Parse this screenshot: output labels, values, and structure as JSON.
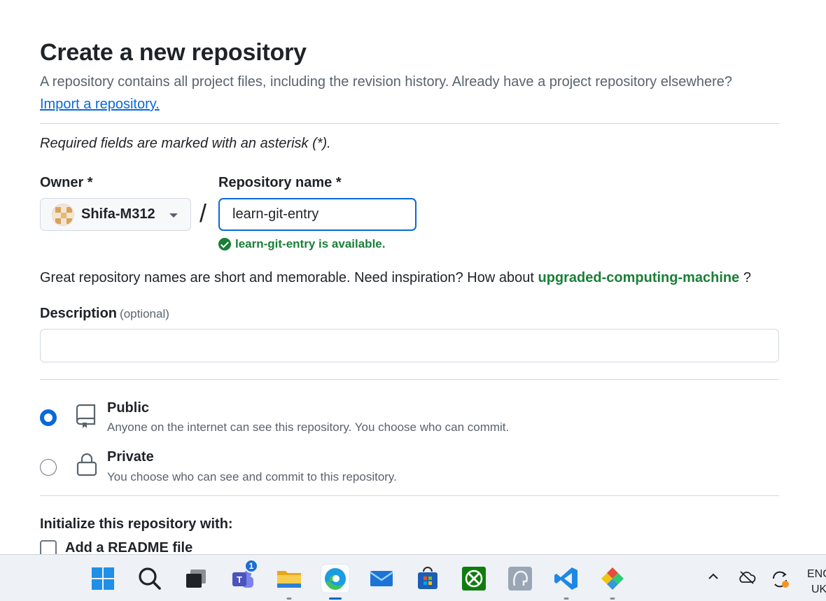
{
  "page": {
    "title": "Create a new repository",
    "subtitle": "A repository contains all project files, including the revision history. Already have a project repository elsewhere?",
    "import_link": "Import a repository.",
    "required_note": "Required fields are marked with an asterisk (*)."
  },
  "owner": {
    "label": "Owner *",
    "value": "Shifa-M312"
  },
  "repo_name": {
    "label": "Repository name *",
    "value": "learn-git-entry",
    "available_msg": "learn-git-entry is available."
  },
  "inspiration": {
    "text": "Great repository names are short and memorable. Need inspiration? How about ",
    "suggestion": "upgraded-computing-machine",
    "suffix": " ?"
  },
  "description": {
    "label": "Description",
    "optional": "(optional)",
    "value": ""
  },
  "visibility": {
    "selected": "public",
    "options": [
      {
        "title": "Public",
        "desc": "Anyone on the internet can see this repository. You choose who can commit."
      },
      {
        "title": "Private",
        "desc": "You choose who can see and commit to this repository."
      }
    ]
  },
  "init": {
    "title": "Initialize this repository with:",
    "readme_label": "Add a README file"
  },
  "taskbar": {
    "teams_badge": "1",
    "lang_line1": "ENG",
    "lang_line2": "UK",
    "icons": [
      "windows-start-icon",
      "search-icon",
      "task-view-icon",
      "teams-icon",
      "file-explorer-icon",
      "edge-icon",
      "mail-icon",
      "store-icon",
      "xbox-icon",
      "app-icon",
      "vscode-icon",
      "git-icon"
    ]
  }
}
